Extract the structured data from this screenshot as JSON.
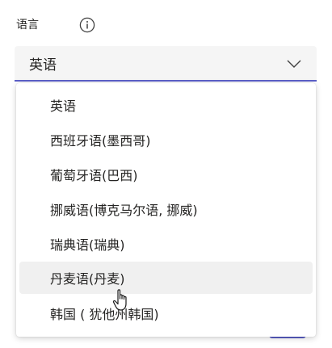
{
  "language_field": {
    "label": "语言",
    "info_icon": "info-icon",
    "selected_value": "英语",
    "chevron_icon": "chevron-down-icon",
    "accent_color": "#5b5fc7"
  },
  "dropdown": {
    "options": [
      {
        "label": "英语"
      },
      {
        "label": "西班牙语(墨西哥)"
      },
      {
        "label": "葡萄牙语(巴西)"
      },
      {
        "label": "挪威语(博克马尔语, 挪威)"
      },
      {
        "label": "瑞典语(瑞典)"
      },
      {
        "label": "丹麦语(丹麦)",
        "hovered": true
      },
      {
        "label": "韩国 ( 犹他州韩国)"
      }
    ],
    "hover_color": "#f0f0f0"
  },
  "cursor": {
    "icon": "hand-pointer-icon"
  }
}
